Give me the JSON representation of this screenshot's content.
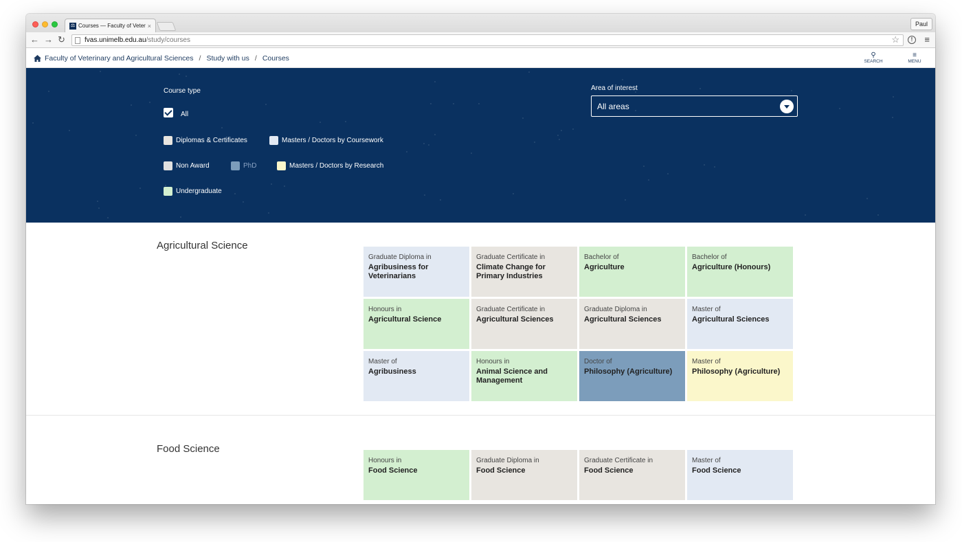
{
  "colors": {
    "diplomas": "#e8e5e0",
    "masters_coursework": "#e2e9f3",
    "non_award": "#e0e0e0",
    "phd": "#7c9dbb",
    "masters_research": "#fbf7cb",
    "undergraduate": "#d3efd0",
    "panel": "#0a3160"
  },
  "browser": {
    "tab_title": "Courses — Faculty of Veterinary",
    "tab_close": "×",
    "profile": "Paul",
    "url_host": "fvas.unimelb.edu.au",
    "url_path": "/study/courses",
    "icons": [
      "back-icon",
      "forward-icon",
      "reload-icon",
      "page-icon",
      "star-icon",
      "info-icon",
      "chrome-menu-icon"
    ]
  },
  "header": {
    "breadcrumb": [
      "Faculty of Veterinary and Agricultural Sciences",
      "Study with us",
      "Courses"
    ],
    "separator": "/",
    "search_label": "SEARCH",
    "menu_label": "MENU"
  },
  "filters": {
    "course_type_label": "Course type",
    "all_label": "All",
    "options": [
      {
        "label": "Diplomas & Certificates",
        "color": "#e8e5e0"
      },
      {
        "label": "Masters / Doctors by Coursework",
        "color": "#e2e9f3"
      },
      {
        "label": "Non Award",
        "color": "#e0e0e0"
      },
      {
        "label": "PhD",
        "color": "#7c9dbb"
      },
      {
        "label": "Masters / Doctors by Research",
        "color": "#fbf7cb"
      },
      {
        "label": "Undergraduate",
        "color": "#d3efd0"
      }
    ],
    "area_label": "Area of interest",
    "area_value": "All areas"
  },
  "sections": [
    {
      "title": "Agricultural Science",
      "courses": [
        {
          "prefix": "Graduate Diploma in",
          "name": "Agribusiness for Veterinarians",
          "type": "masters_coursework"
        },
        {
          "prefix": "Graduate Certificate in",
          "name": "Climate Change for Primary Industries",
          "type": "diplomas"
        },
        {
          "prefix": "Bachelor of",
          "name": "Agriculture",
          "type": "undergraduate"
        },
        {
          "prefix": "Bachelor of",
          "name": "Agriculture (Honours)",
          "type": "undergraduate"
        },
        {
          "prefix": "Honours in",
          "name": "Agricultural Science",
          "type": "undergraduate"
        },
        {
          "prefix": "Graduate Certificate in",
          "name": "Agricultural Sciences",
          "type": "diplomas"
        },
        {
          "prefix": "Graduate Diploma in",
          "name": "Agricultural Sciences",
          "type": "diplomas"
        },
        {
          "prefix": "Master of",
          "name": "Agricultural Sciences",
          "type": "masters_coursework"
        },
        {
          "prefix": "Master of",
          "name": "Agribusiness",
          "type": "masters_coursework"
        },
        {
          "prefix": "Honours in",
          "name": "Animal Science and Management",
          "type": "undergraduate"
        },
        {
          "prefix": "Doctor of",
          "name": "Philosophy (Agriculture)",
          "type": "phd"
        },
        {
          "prefix": "Master of",
          "name": "Philosophy (Agriculture)",
          "type": "masters_research"
        }
      ]
    },
    {
      "title": "Food Science",
      "courses": [
        {
          "prefix": "Honours in",
          "name": "Food Science",
          "type": "undergraduate"
        },
        {
          "prefix": "Graduate Diploma in",
          "name": "Food Science",
          "type": "diplomas"
        },
        {
          "prefix": "Graduate Certificate in",
          "name": "Food Science",
          "type": "diplomas"
        },
        {
          "prefix": "Master of",
          "name": "Food Science",
          "type": "masters_coursework"
        }
      ]
    }
  ]
}
